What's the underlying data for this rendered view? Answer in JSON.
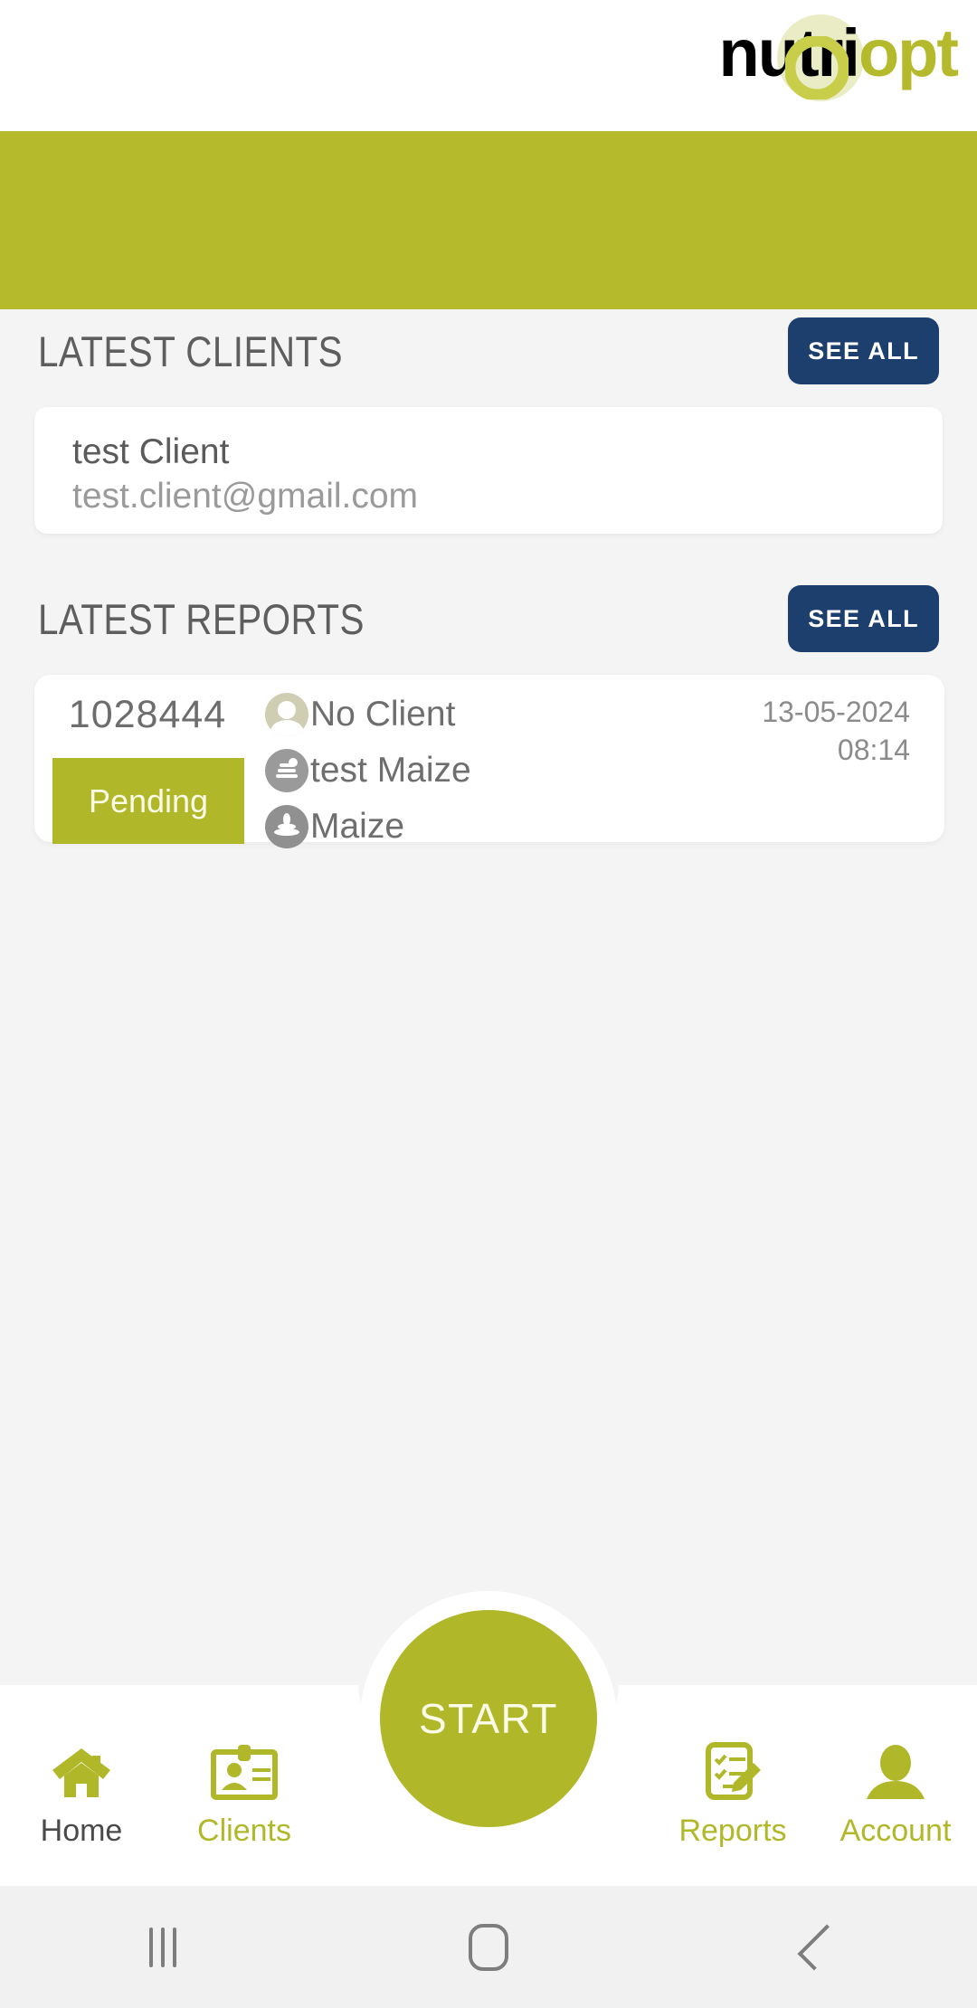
{
  "brand": {
    "logo_nutri": "nutri",
    "logo_opt": "opt",
    "color_navy": "#0d4071",
    "color_olive": "#b5ba2c",
    "color_halo": "#e9ecc4"
  },
  "theme": {
    "page_background": "#f4f4f4",
    "banner_green": "#b5ba2c",
    "button_navy": "#1c3f6e",
    "badge_green": "#b0b829",
    "card_white": "#ffffff",
    "text_gray": "#6e6e6e",
    "text_light_gray": "#9a9a9a"
  },
  "clients_section": {
    "title": "LATEST CLIENTS",
    "see_all_label": "SEE ALL",
    "items": [
      {
        "name": "test Client",
        "email": "test.client@gmail.com"
      }
    ]
  },
  "reports_section": {
    "title": "LATEST REPORTS",
    "see_all_label": "SEE ALL",
    "items": [
      {
        "id": "1028444",
        "status": "Pending",
        "client": "No Client",
        "sample": "test Maize",
        "crop": "Maize",
        "date": "13-05-2024",
        "time": "08:14"
      }
    ]
  },
  "start_button": {
    "label": "START"
  },
  "bottom_nav": {
    "items": [
      {
        "label": "Home",
        "icon": "home-icon",
        "active": true
      },
      {
        "label": "Clients",
        "icon": "id-card-icon",
        "active": false
      },
      {
        "label": "Reports",
        "icon": "clipboard-pencil-icon",
        "active": false
      },
      {
        "label": "Account",
        "icon": "person-icon",
        "active": false
      }
    ]
  },
  "system_bar": {
    "recents_label": "|||",
    "home_label": "home",
    "back_label": "back"
  }
}
